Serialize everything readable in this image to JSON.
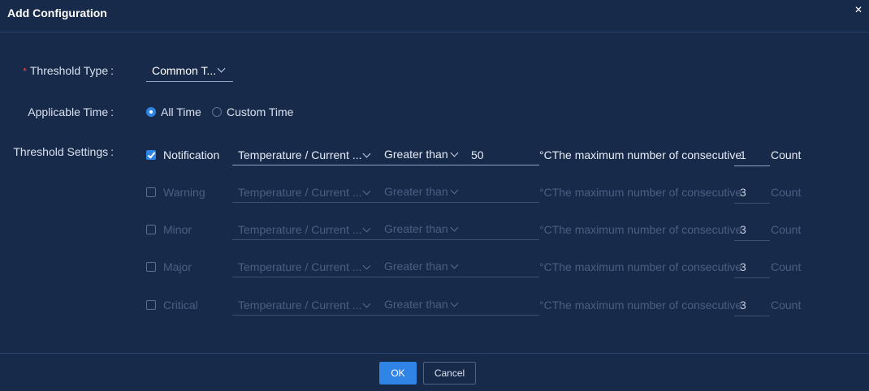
{
  "dialog": {
    "title": "Add Configuration",
    "close_icon": "close-icon"
  },
  "form": {
    "threshold_type": {
      "label": "Threshold Type",
      "required_mark": "*",
      "value": "Common T..."
    },
    "applicable_time": {
      "label": "Applicable Time",
      "options": [
        "All Time",
        "Custom Time"
      ],
      "selected": "All Time"
    },
    "threshold_settings": {
      "label": "Threshold Settings",
      "rows": [
        {
          "checked": true,
          "severity": "Notification",
          "metric": "Temperature / Current ...",
          "operator": "Greater than",
          "value": "50",
          "description": "°CThe maximum number of consecutive",
          "count": "1",
          "unit": "Count"
        },
        {
          "checked": false,
          "severity": "Warning",
          "metric": "Temperature / Current ...",
          "operator": "Greater than",
          "value": "",
          "description": "°CThe maximum number of consecutive",
          "count": "3",
          "unit": "Count"
        },
        {
          "checked": false,
          "severity": "Minor",
          "metric": "Temperature / Current ...",
          "operator": "Greater than",
          "value": "",
          "description": "°CThe maximum number of consecutive",
          "count": "3",
          "unit": "Count"
        },
        {
          "checked": false,
          "severity": "Major",
          "metric": "Temperature / Current ...",
          "operator": "Greater than",
          "value": "",
          "description": "°CThe maximum number of consecutive",
          "count": "3",
          "unit": "Count"
        },
        {
          "checked": false,
          "severity": "Critical",
          "metric": "Temperature / Current ...",
          "operator": "Greater than",
          "value": "",
          "description": "°CThe maximum number of consecutive",
          "count": "3",
          "unit": "Count"
        }
      ]
    },
    "label_colon": ":"
  },
  "footer": {
    "ok_label": "OK",
    "cancel_label": "Cancel"
  },
  "colors": {
    "background": "#182a4a",
    "accent": "#2f84e6",
    "required": "#f04545"
  }
}
